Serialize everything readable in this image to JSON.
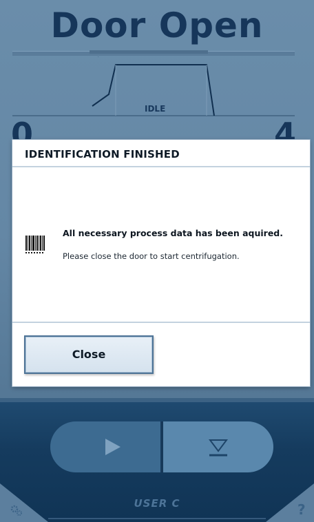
{
  "status": {
    "title": "Door Open",
    "phase_label": "IDLE",
    "speed_left": "0",
    "speed_right": "4"
  },
  "dialog": {
    "title": "IDENTIFICATION FINISHED",
    "icon": "barcode-icon",
    "message_main": "All necessary process data has been aquired.",
    "message_sub": "Please close the door to start centrifugation.",
    "close_label": "Close"
  },
  "controls": {
    "start_icon": "play-icon",
    "stop_icon": "stop-icon",
    "user_label": "USER C",
    "settings_icon": "gear-icon",
    "help_icon": "?"
  },
  "colors": {
    "background": "#6487a5",
    "title": "#16365a",
    "panel": "#153b5e",
    "dialog_border": "#4d7396"
  }
}
